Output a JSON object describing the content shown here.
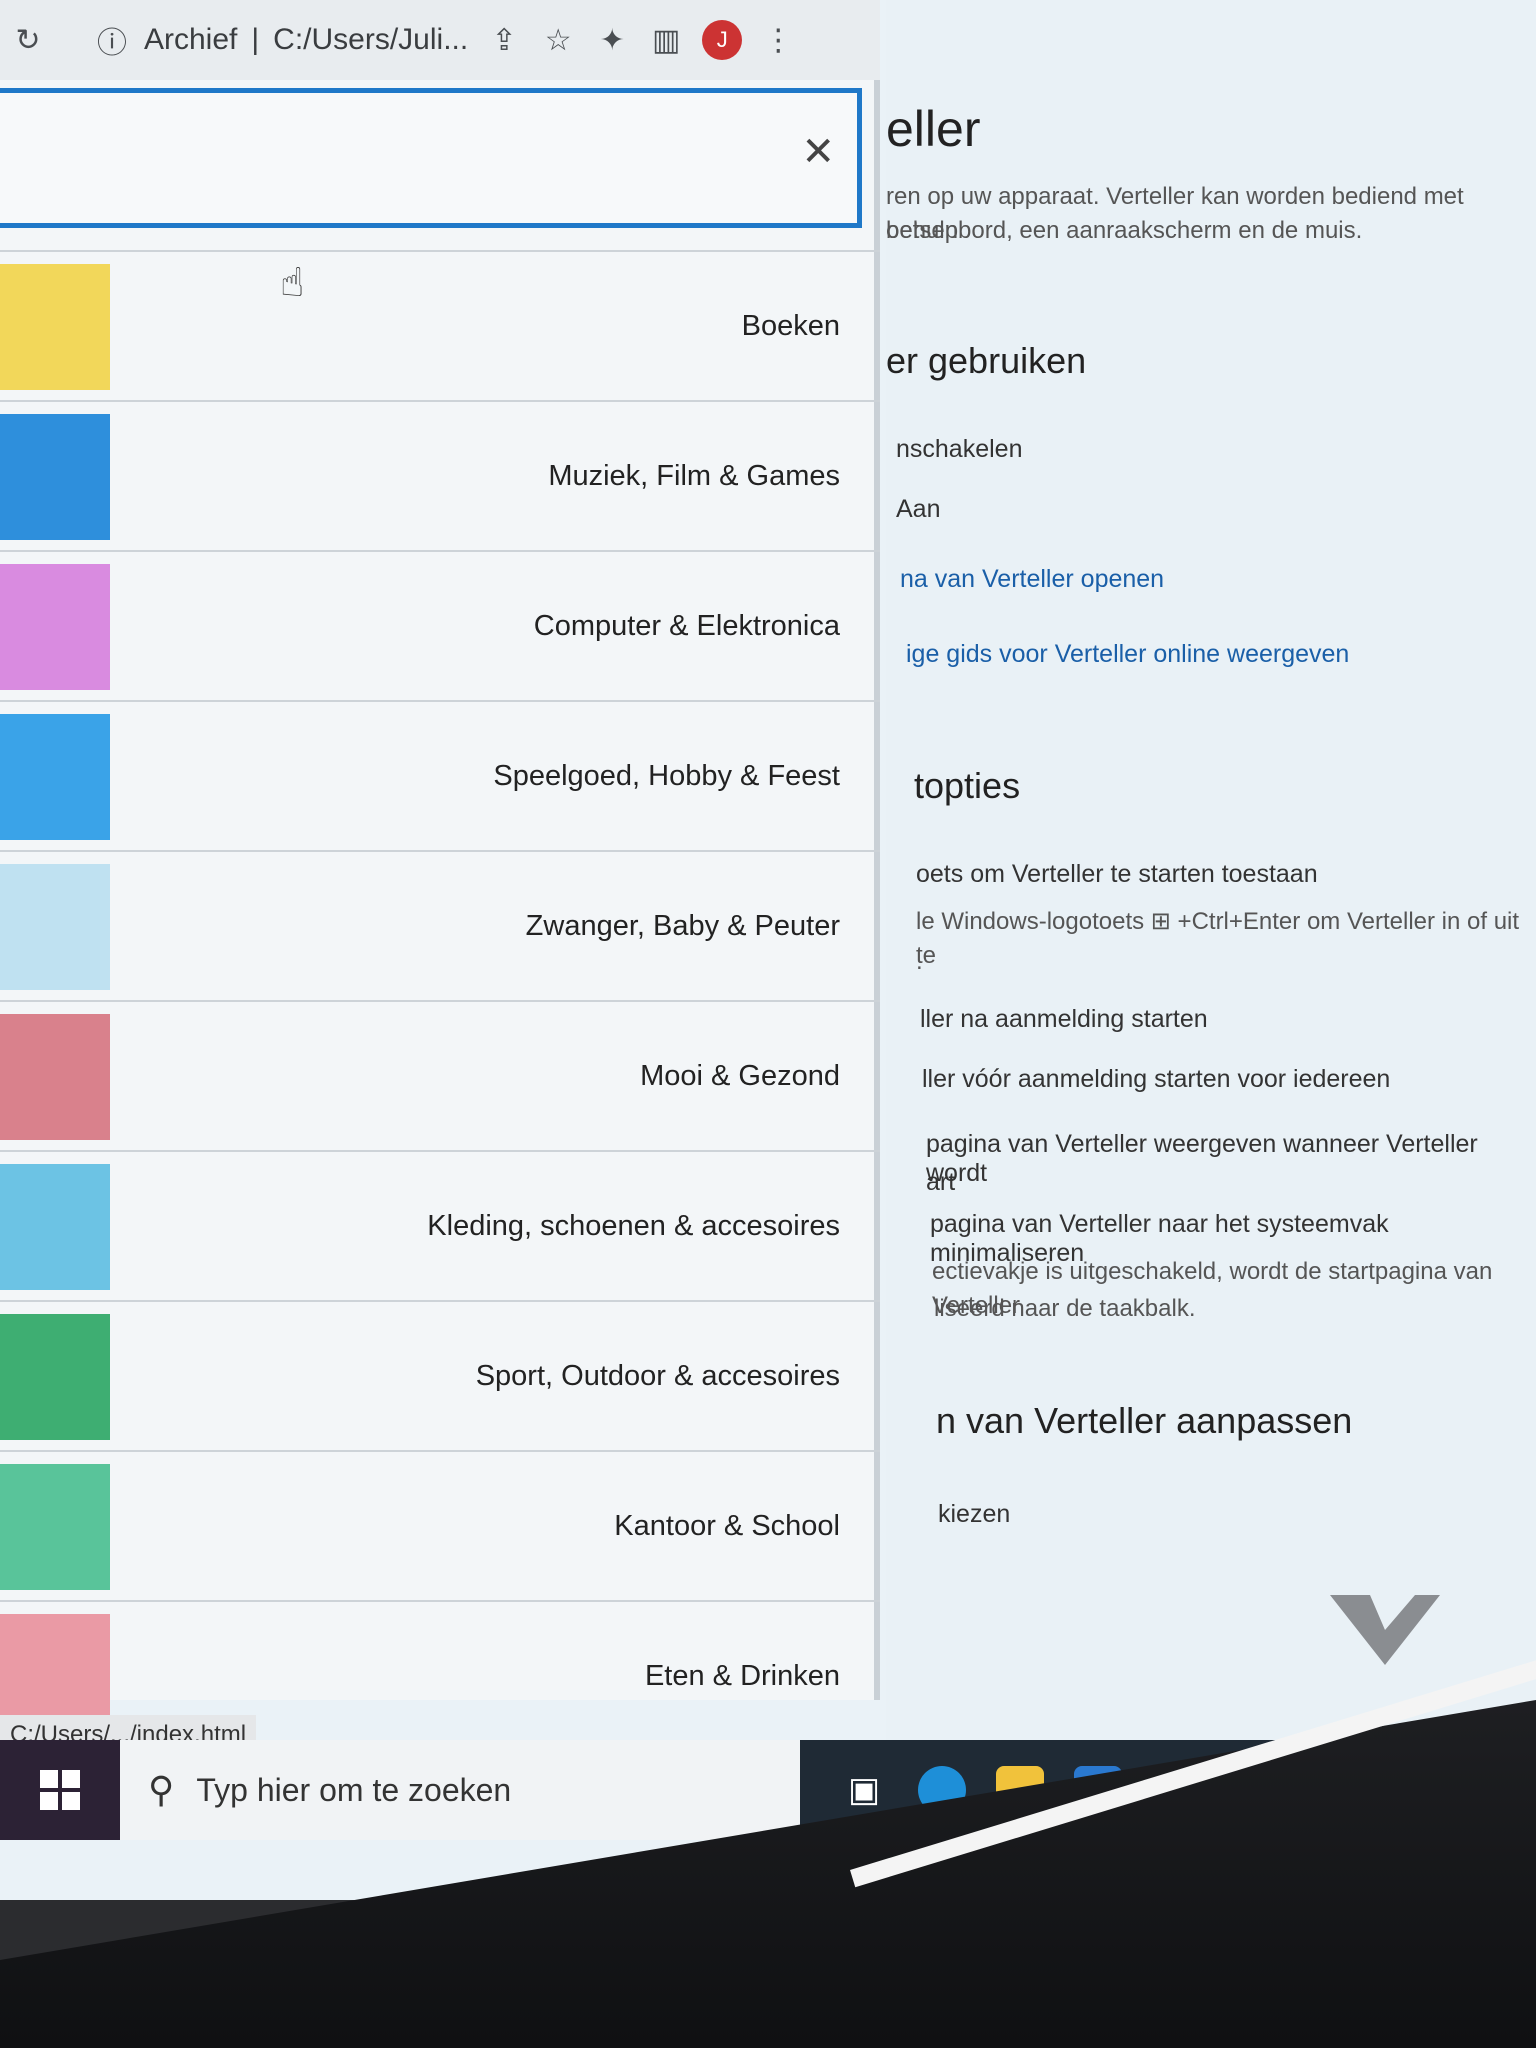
{
  "browser": {
    "address_bar": {
      "site_label": "Archief",
      "separator": "|",
      "url_text": "C:/Users/Juli...",
      "profile_initial": "J"
    },
    "status_url": "C:/Users/.../index.html",
    "menu": {
      "items": [
        {
          "label": "Boeken",
          "thumb_color": "#f2d75a"
        },
        {
          "label": "Muziek, Film & Games",
          "thumb_color": "#2e8fdc"
        },
        {
          "label": "Computer & Elektronica",
          "thumb_color": "#d98be0"
        },
        {
          "label": "Speelgoed, Hobby & Feest",
          "thumb_color": "#3aa3e8"
        },
        {
          "label": "Zwanger, Baby & Peuter",
          "thumb_color": "#bfe1f1"
        },
        {
          "label": "Mooi & Gezond",
          "thumb_color": "#d9818c"
        },
        {
          "label": "Kleding, schoenen & accesoires",
          "thumb_color": "#6cc3e4"
        },
        {
          "label": "Sport, Outdoor & accesoires",
          "thumb_color": "#3eae72"
        },
        {
          "label": "Kantoor & School",
          "thumb_color": "#59c49a"
        },
        {
          "label": "Eten & Drinken",
          "thumb_color": "#ea9aa5"
        }
      ]
    }
  },
  "taskbar": {
    "search_placeholder": "Typ hier om te zoeken"
  },
  "settings": {
    "title": "eller",
    "intro_line1": "ren op uw apparaat. Verteller kan worden bediend met behulp",
    "intro_line2": "oetsenbord, een aanraakscherm en de muis.",
    "section1_heading": "er gebruiken",
    "toggle_label": "nschakelen",
    "toggle_state": "Aan",
    "link1": "na van Verteller openen",
    "link2": "ige gids voor Verteller online weergeven",
    "section2_heading": "topties",
    "opt1": "oets om Verteller te starten toestaan",
    "opt1_desc": "le Windows-logotoets ⊞ +Ctrl+Enter om Verteller in of uit te",
    "opt1_desc2": ".",
    "opt2": "ller na aanmelding starten",
    "opt3": "ller vóór aanmelding starten voor iedereen",
    "opt4": "pagina van Verteller weergeven wanneer Verteller wordt",
    "opt4b": "art",
    "opt5": "pagina van Verteller naar het systeemvak minimaliseren",
    "opt5_desc": "ectievakje is uitgeschakeld, wordt de startpagina van Verteller",
    "opt5_desc2": "liseerd naar de taakbalk.",
    "section3_heading": "n van Verteller aanpassen",
    "choose": "kiezen"
  }
}
